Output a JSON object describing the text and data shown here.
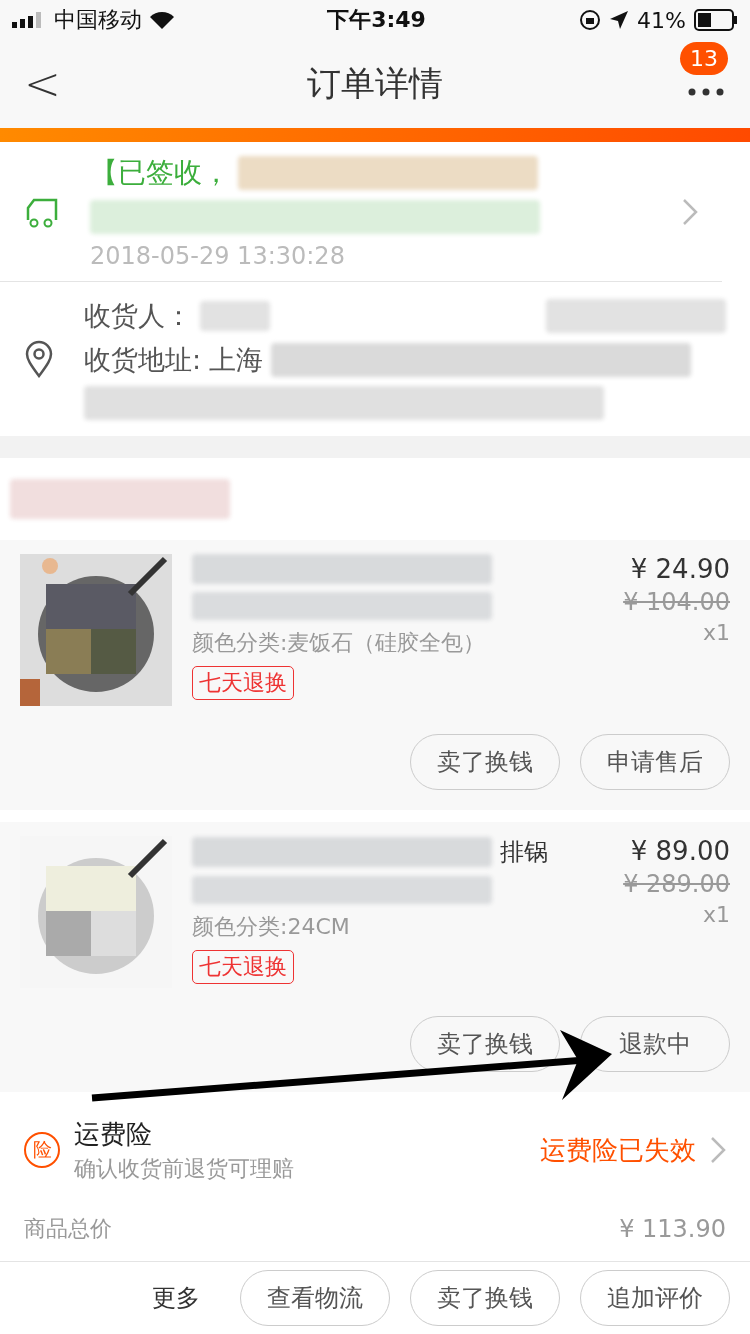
{
  "status_bar": {
    "carrier": "中国移动",
    "time": "下午3:49",
    "battery": "41%"
  },
  "nav": {
    "back": "<",
    "title": "订单详情",
    "badge": "13"
  },
  "logistics": {
    "status": "【已签收，",
    "time": "2018-05-29 13:30:28"
  },
  "address": {
    "receiver_label": "收货人：",
    "address_label": "收货地址:",
    "address_value": "上海"
  },
  "items": [
    {
      "price": "¥ 24.90",
      "original_price": "¥ 104.00",
      "qty": "x1",
      "sku": "颜色分类:麦饭石（硅胶全包）",
      "tag": "七天退换",
      "buttons": [
        "卖了换钱",
        "申请售后"
      ]
    },
    {
      "title_fragment": "排锅",
      "price": "¥ 89.00",
      "original_price": "¥ 289.00",
      "qty": "x1",
      "sku": "颜色分类:24CM",
      "tag": "七天退换",
      "buttons": [
        "卖了换钱",
        "退款中"
      ]
    }
  ],
  "insurance": {
    "icon_text": "险",
    "title": "运费险",
    "subtitle": "确认收货前退货可理赔",
    "status": "运费险已失效"
  },
  "total": {
    "label": "商品总价",
    "value": "¥ 113.90"
  },
  "bottom_bar": {
    "more": "更多",
    "buttons": [
      "查看物流",
      "卖了换钱",
      "追加评价"
    ]
  }
}
